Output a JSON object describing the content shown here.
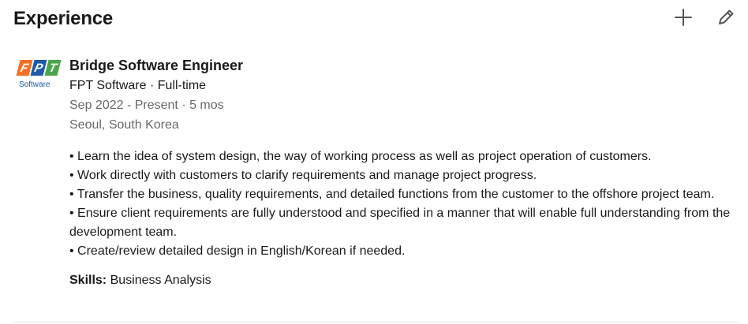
{
  "section": {
    "title": "Experience",
    "add_icon": "plus-icon",
    "edit_icon": "pencil-icon"
  },
  "company_logo": {
    "letters": [
      "F",
      "P",
      "T"
    ],
    "tile_colors": [
      "#f27024",
      "#1f5ba8",
      "#49a54b"
    ],
    "caption": "Software"
  },
  "experience": {
    "title": "Bridge Software Engineer",
    "company_line": "FPT Software · Full-time",
    "date_line": "Sep 2022 - Present · 5 mos",
    "location": "Seoul, South Korea",
    "description": [
      "• Learn the idea of system design, the way of working process as well as project operation of customers.",
      "• Work directly with customers to clarify requirements and manage project progress.",
      "• Transfer the business, quality requirements, and detailed functions from the customer to the offshore project team.",
      "• Ensure client requirements are fully understood and specified in a manner that will enable full understanding from the development team.",
      "• Create/review detailed design in English/Korean if needed."
    ],
    "skills_label": "Skills:",
    "skills_value": "Business Analysis"
  }
}
